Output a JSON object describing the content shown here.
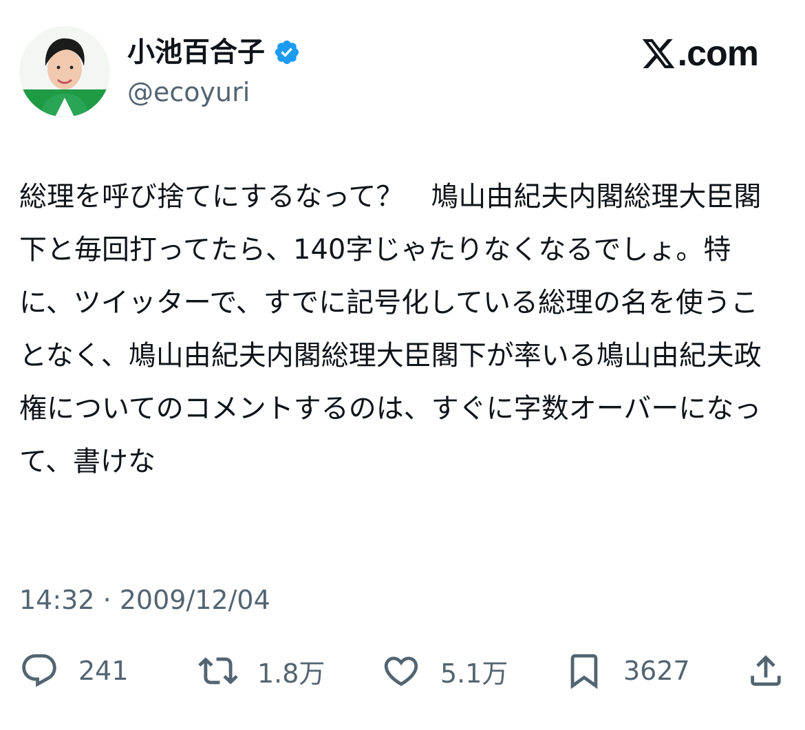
{
  "user": {
    "display_name": "小池百合子",
    "handle": "@ecoyuri",
    "verified_icon": "verified-badge-icon",
    "avatar_icon": "profile-avatar"
  },
  "brand": {
    "text": ".com",
    "icon": "x-logo-icon"
  },
  "tweet": {
    "text": "総理を呼び捨てにするなって？　鳩山由紀夫内閣総理大臣閣下と毎回打ってたら、140字じゃたりなくなるでしょ。特に、ツイッターで、すでに記号化している総理の名を使うことなく、鳩山由紀夫内閣総理大臣閣下が率いる鳩山由紀夫政権についてのコメントするのは、すぐに字数オーバーになって、書けな"
  },
  "meta": {
    "timestamp": "14:32 · 2009/12/04"
  },
  "actions": {
    "reply": {
      "icon": "reply-icon",
      "count": "241"
    },
    "retweet": {
      "icon": "retweet-icon",
      "count": "1.8万"
    },
    "like": {
      "icon": "like-icon",
      "count": "5.1万"
    },
    "bookmark": {
      "icon": "bookmark-icon",
      "count": "3627"
    },
    "share": {
      "icon": "share-icon"
    }
  },
  "colors": {
    "text_primary": "#0f1419",
    "text_secondary": "#536471",
    "verified_blue": "#1d9bf0"
  }
}
